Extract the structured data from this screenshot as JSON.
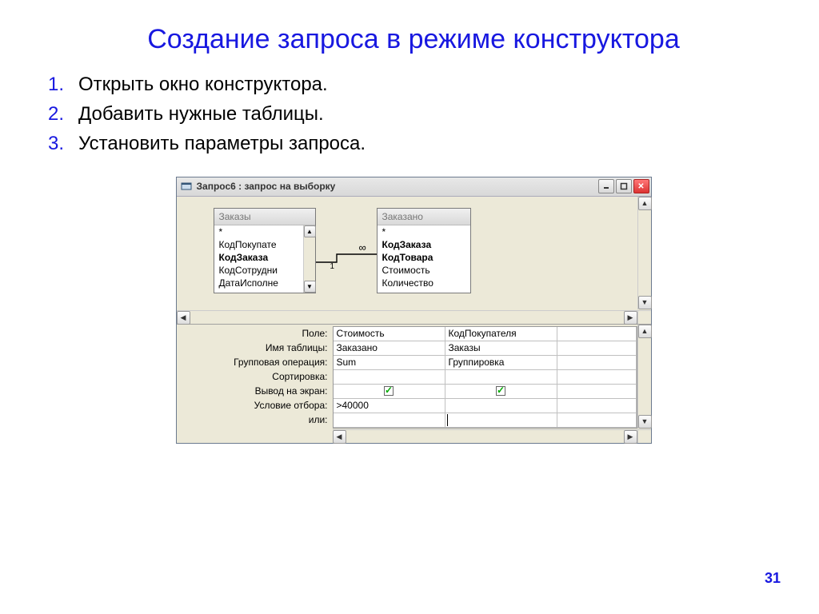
{
  "slide": {
    "title": "Создание запроса в режиме конструктора",
    "items": [
      "Открыть окно конструктора.",
      "Добавить нужные таблицы.",
      "Установить параметры запроса."
    ],
    "page_number": "31"
  },
  "window": {
    "title": "Запрос6 : запрос на выборку",
    "relation": {
      "left_label": "1",
      "right_label": "∞"
    },
    "tables": [
      {
        "name": "Заказы",
        "fields": [
          "*",
          "КодПокупате",
          "КодЗаказа",
          "КодСотрудни",
          "ДатаИсполне"
        ],
        "bold_indices": [
          2
        ]
      },
      {
        "name": "Заказано",
        "fields": [
          "*",
          "КодЗаказа",
          "КодТовара",
          "Стоимость",
          "Количество"
        ],
        "bold_indices": [
          1,
          2
        ]
      }
    ],
    "grid": {
      "row_labels": [
        "Поле:",
        "Имя таблицы:",
        "Групповая операция:",
        "Сортировка:",
        "Вывод на экран:",
        "Условие отбора:",
        "или:"
      ],
      "columns": [
        {
          "field": "Стоимость",
          "table": "Заказано",
          "group_op": "Sum",
          "sort": "",
          "show": true,
          "criteria": ">40000",
          "or": ""
        },
        {
          "field": "КодПокупателя",
          "table": "Заказы",
          "group_op": "Группировка",
          "sort": "",
          "show": true,
          "criteria": "",
          "or": ""
        }
      ]
    }
  }
}
